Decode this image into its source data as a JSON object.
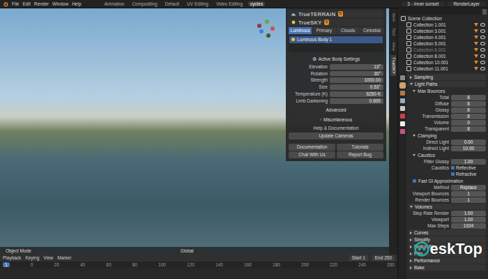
{
  "top_bar": {
    "menu": [
      "File",
      "Edit",
      "Render",
      "Window",
      "Help"
    ],
    "workspaces": [
      {
        "label": "Animation",
        "selected": false
      },
      {
        "label": "Compositing",
        "selected": false
      },
      {
        "label": "Default",
        "selected": false
      },
      {
        "label": "UV Editing",
        "selected": false
      },
      {
        "label": "Video Editing",
        "selected": false
      },
      {
        "label": "cycles",
        "selected": true
      }
    ],
    "scene": "3 - Inner sunset",
    "view_layer": "RenderLayer"
  },
  "viewport": {
    "mode": "Object Mode",
    "orientation": "Global",
    "gizmo_dots": [
      {
        "color": "#e0414f"
      },
      {
        "color": "#6aa833"
      },
      {
        "color": "#3f7fe0"
      },
      {
        "color": "#8e3a44"
      },
      {
        "color": "#3a5a2a"
      }
    ]
  },
  "sidebar_tabs": [
    {
      "label": "Item",
      "selected": false
    },
    {
      "label": "Tool",
      "selected": false
    },
    {
      "label": "View",
      "selected": false
    },
    {
      "label": "TrueSKY",
      "selected": true
    }
  ],
  "addon": {
    "brand_terrain": "TrueTERRAIN",
    "brand_sky": "TrueSKY",
    "badge": "5",
    "tabs": [
      {
        "label": "Luminous",
        "selected": true
      },
      {
        "label": "Primary",
        "selected": false
      },
      {
        "label": "Clouds",
        "selected": false
      },
      {
        "label": "Celestial",
        "selected": false
      }
    ],
    "list_item": "Luminous Body 1",
    "section": "Active Body Settings",
    "elevation": {
      "label": "Elevation",
      "value": "13°"
    },
    "fields": [
      {
        "label": "Rotation",
        "value": "30°"
      },
      {
        "label": "Strength",
        "value": "1000.00"
      },
      {
        "label": "Size",
        "value": "0.53°"
      },
      {
        "label": "Temperature (K)",
        "value": "6250 K"
      },
      {
        "label": "Limb Darkening",
        "value": "0.600"
      }
    ],
    "advanced": "Advanced",
    "misc": "Miscellaneous",
    "help": "Help & Documentation",
    "update": "Update Cameras",
    "links": [
      "Documentation",
      "Tutorials",
      "Chat With Us",
      "Report Bug"
    ]
  },
  "outliner": {
    "items": [
      {
        "label": "Scene Collection",
        "kind": "root",
        "excluded": false
      },
      {
        "label": "Collection 1.001",
        "kind": "collection",
        "excluded": false
      },
      {
        "label": "Collection 3.001",
        "kind": "collection",
        "excluded": false
      },
      {
        "label": "Collection 4.001",
        "kind": "collection",
        "excluded": false
      },
      {
        "label": "Collection 5.001",
        "kind": "collection",
        "excluded": false
      },
      {
        "label": "Collection 6.001",
        "kind": "collection",
        "excluded": true
      },
      {
        "label": "Collection 8.001",
        "kind": "collection",
        "excluded": false
      },
      {
        "label": "Collection 10.001",
        "kind": "collection",
        "excluded": false
      },
      {
        "label": "Collection 11.001",
        "kind": "collection",
        "excluded": false
      }
    ]
  },
  "properties": {
    "rows": [
      {
        "kind": "panel",
        "label": "Sampling",
        "expanded": false
      },
      {
        "kind": "panel",
        "label": "Light Paths",
        "expanded": true
      },
      {
        "kind": "sub",
        "label": "Max Bounces",
        "expanded": true
      },
      {
        "kind": "field",
        "label": "Total",
        "value": "8"
      },
      {
        "kind": "field",
        "label": "Diffuse",
        "value": "8"
      },
      {
        "kind": "field",
        "label": "Glossy",
        "value": "8"
      },
      {
        "kind": "field",
        "label": "Transmission",
        "value": "8"
      },
      {
        "kind": "field",
        "label": "Volume",
        "value": "0"
      },
      {
        "kind": "field",
        "label": "Transparent",
        "value": "8"
      },
      {
        "kind": "sub",
        "label": "Clamping",
        "expanded": true
      },
      {
        "kind": "field",
        "label": "Direct Light",
        "value": "0.00"
      },
      {
        "kind": "field",
        "label": "Indirect Light",
        "value": "10.00"
      },
      {
        "kind": "sub",
        "label": "Caustics",
        "expanded": true
      },
      {
        "kind": "field",
        "label": "Filter Glossy",
        "value": "1.00"
      },
      {
        "kind": "check",
        "label": "Caustics",
        "text": "Reflective",
        "checked": true
      },
      {
        "kind": "check",
        "label": "",
        "text": "Refractive",
        "checked": true
      },
      {
        "kind": "subcheck",
        "label": "Fast GI Approximation",
        "checked": true
      },
      {
        "kind": "field",
        "label": "Method",
        "value": "Replace"
      },
      {
        "kind": "field",
        "label": "Viewport Bounces",
        "value": "1"
      },
      {
        "kind": "field",
        "label": "Render Bounces",
        "value": "1"
      },
      {
        "kind": "panel",
        "label": "Volumes",
        "expanded": true
      },
      {
        "kind": "field",
        "label": "Step Rate Render",
        "value": "1.00"
      },
      {
        "kind": "field",
        "label": "Viewport",
        "value": "1.00"
      },
      {
        "kind": "field",
        "label": "Max Steps",
        "value": "1024"
      },
      {
        "kind": "panel",
        "label": "Curves",
        "expanded": false
      },
      {
        "kind": "panel",
        "label": "Simplify",
        "expanded": false
      },
      {
        "kind": "panel",
        "label": "Motion Blur",
        "expanded": false
      },
      {
        "kind": "panel",
        "label": "Film",
        "expanded": false
      },
      {
        "kind": "panel",
        "label": "Performance",
        "expanded": false
      },
      {
        "kind": "panel",
        "label": "Bake",
        "expanded": false
      }
    ]
  },
  "timeline": {
    "menus": [
      "Playback",
      "Keying",
      "View",
      "Marker"
    ],
    "current": "1",
    "start_label": "Start",
    "start": "1",
    "end_label": "End",
    "end": "250",
    "ticks": [
      "0",
      "20",
      "40",
      "60",
      "80",
      "100",
      "120",
      "140",
      "160",
      "180",
      "200",
      "220",
      "240",
      "260"
    ]
  },
  "watermark": "eskTop"
}
